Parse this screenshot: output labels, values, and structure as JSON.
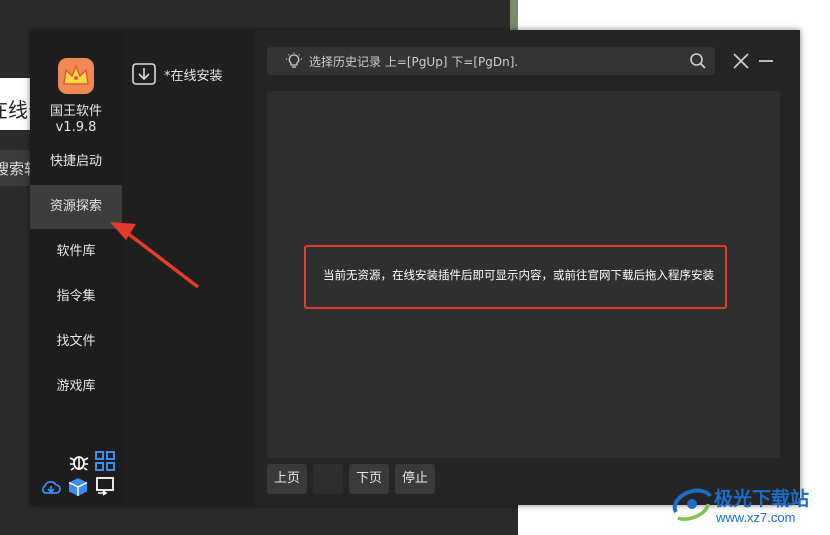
{
  "background": {
    "partial_text_1": "在线安",
    "partial_text_2": "搜索软"
  },
  "app": {
    "name": "国王软件",
    "version": "v1.9.8",
    "accent": "#f08a52"
  },
  "sidebar": {
    "items": [
      {
        "label": "快捷启动",
        "active": false
      },
      {
        "label": "资源探索",
        "active": true
      },
      {
        "label": "软件库",
        "active": false
      },
      {
        "label": "指令集",
        "active": false
      },
      {
        "label": "找文件",
        "active": false
      },
      {
        "label": "游戏库",
        "active": false
      }
    ],
    "icons": [
      "bug-icon",
      "grid-icon",
      "cloud-download-icon",
      "cube-icon",
      "screen-share-icon"
    ]
  },
  "middle": {
    "online_install": "*在线安装"
  },
  "search": {
    "placeholder": "选择历史记录 上=[PgUp] 下=[PgDn]."
  },
  "content": {
    "empty_message": "当前无资源，在线安装插件后即可显示内容，或前往官网下载后拖入程序安装",
    "highlight_color": "#e53a2e"
  },
  "pager": {
    "prev": "上页",
    "next": "下页",
    "stop": "停止"
  },
  "watermark": {
    "title": "极光下载站",
    "url": "www.xz7.com"
  }
}
